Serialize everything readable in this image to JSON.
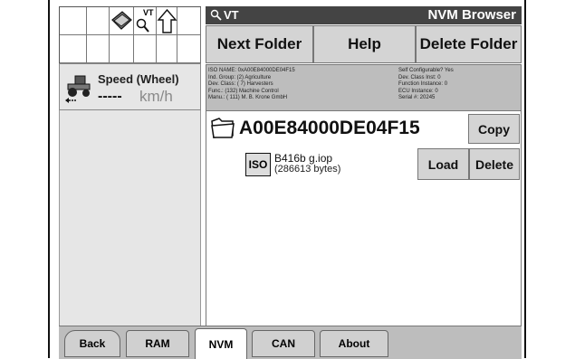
{
  "header": {
    "vt_label": "VT",
    "title": "NVM Browser"
  },
  "toolbar": {
    "next_folder": "Next Folder",
    "help": "Help",
    "delete_folder": "Delete Folder"
  },
  "speed": {
    "label": "Speed (Wheel)",
    "value": "-----",
    "unit": "km/h"
  },
  "icons": {
    "grid_vt_label": "VT"
  },
  "device_info": {
    "left": [
      "ISO NAME: 0xA00E84000DE04F15",
      "Ind. Group: (2) Agriculture",
      "Dev. Class: ( 7) Harvesters",
      "Func.: (132) Machine Control",
      "Manu.: ( 111) M. B. Krone GmbH"
    ],
    "right": [
      "Self Configurable? Yes",
      "Dev. Class Inst: 0",
      "Function Instance: 0",
      "ECU Instance: 0",
      "Serial #: 20245"
    ]
  },
  "folder": {
    "name": "A00E84000DE04F15",
    "copy_label": "Copy"
  },
  "file": {
    "badge": "ISO",
    "name": "B416b g.iop",
    "size": "(286613 bytes)",
    "load_label": "Load",
    "delete_label": "Delete"
  },
  "tabs": [
    "Back",
    "RAM",
    "NVM",
    "CAN",
    "About"
  ],
  "active_tab": "NVM"
}
